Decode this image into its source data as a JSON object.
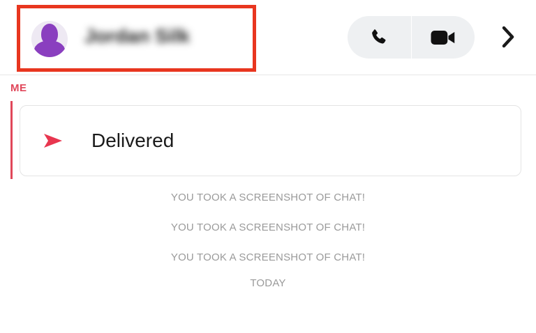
{
  "header": {
    "contact_name": "Jordan Silk",
    "icons": {
      "avatar": "person-silhouette-icon",
      "call": "phone-icon",
      "video": "video-camera-icon",
      "more": "chevron-right-icon"
    },
    "accent_color": "#e8361f"
  },
  "conversation": {
    "sender_label": "ME",
    "sender_color": "#e0475a",
    "message": {
      "status": "Delivered",
      "icon": "sent-arrow-icon"
    },
    "system_messages": [
      "YOU TOOK A SCREENSHOT OF CHAT!",
      "YOU TOOK A SCREENSHOT OF CHAT!",
      "YOU TOOK A SCREENSHOT OF CHAT!"
    ],
    "date_label": "TODAY"
  }
}
